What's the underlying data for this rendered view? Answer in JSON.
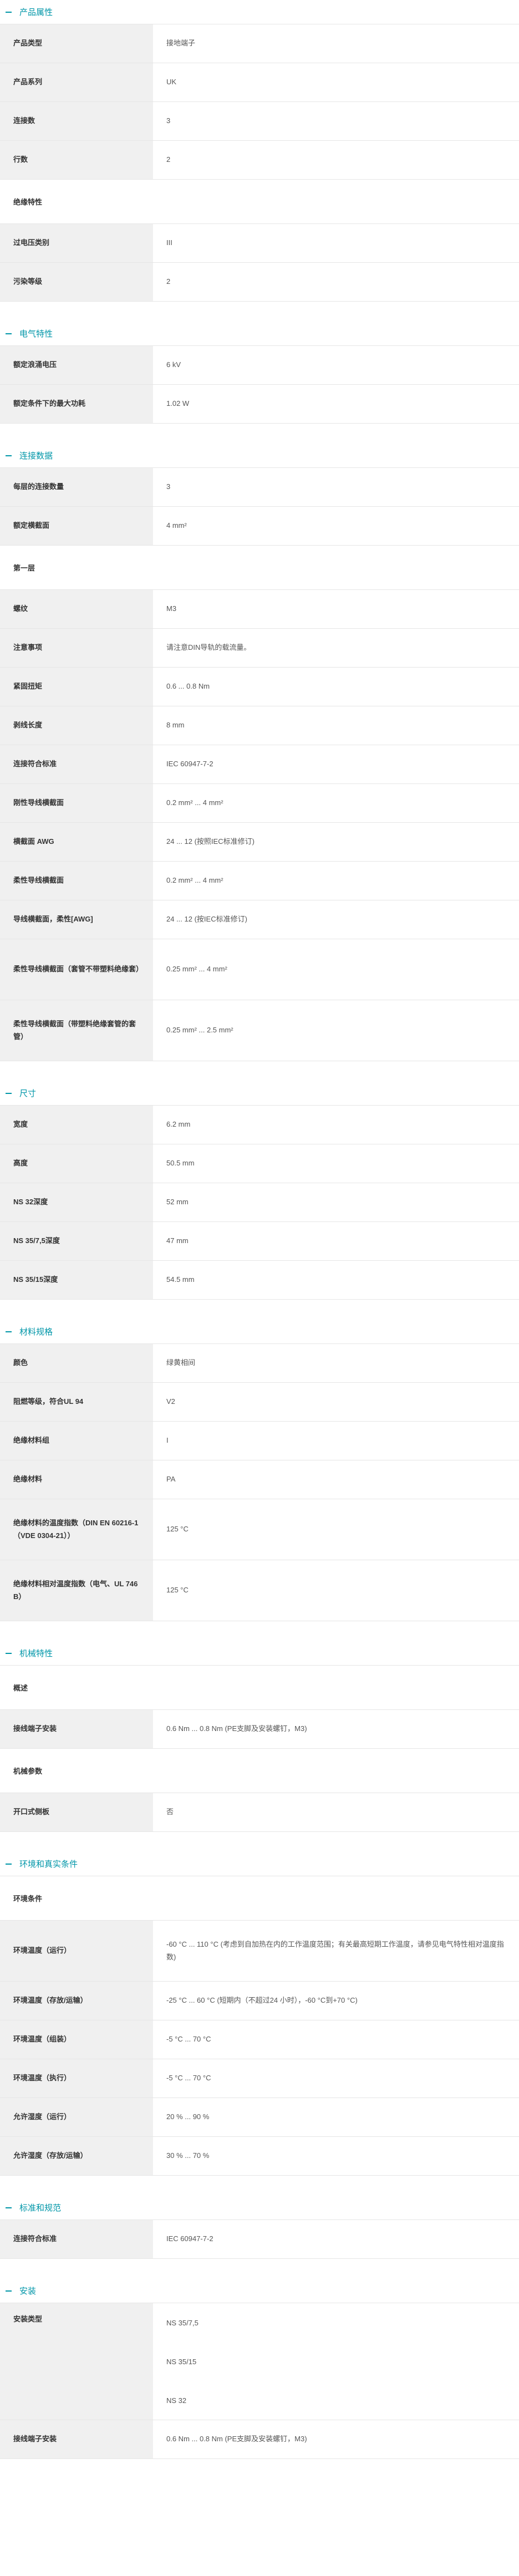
{
  "sections": {
    "product": {
      "title": "产品属性",
      "rows": [
        {
          "k": "产品类型",
          "v": "接地端子"
        },
        {
          "k": "产品系列",
          "v": "UK"
        },
        {
          "k": "连接数",
          "v": "3"
        },
        {
          "k": "行数",
          "v": "2"
        }
      ],
      "insulation_title": "绝缘特性",
      "insulation_rows": [
        {
          "k": "过电压类别",
          "v": "III"
        },
        {
          "k": "污染等级",
          "v": "2"
        }
      ]
    },
    "electrical": {
      "title": "电气特性",
      "rows": [
        {
          "k": "额定浪涌电压",
          "v": "6 kV"
        },
        {
          "k": "额定条件下的最大功耗",
          "v": "1.02 W"
        }
      ]
    },
    "connection": {
      "title": "连接数据",
      "rows": [
        {
          "k": "每层的连接数量",
          "v": "3"
        },
        {
          "k": "额定横截面",
          "v": "4 mm²"
        }
      ],
      "level_title": "第一层",
      "level_rows": [
        {
          "k": "螺纹",
          "v": "M3"
        },
        {
          "k": "注意事项",
          "v": "请注意DIN导轨的载流量。"
        },
        {
          "k": "紧固扭矩",
          "v": "0.6 ... 0.8 Nm"
        },
        {
          "k": "剥线长度",
          "v": "8 mm"
        },
        {
          "k": "连接符合标准",
          "v": "IEC 60947-7-2"
        },
        {
          "k": "刚性导线横截面",
          "v": "0.2 mm² ... 4 mm²"
        },
        {
          "k": "横截面 AWG",
          "v": "24 ... 12 (按照IEC标准修订)"
        },
        {
          "k": "柔性导线横截面",
          "v": "0.2 mm² ... 4 mm²"
        },
        {
          "k": "导线横截面，柔性[AWG]",
          "v": "24 ... 12 (按IEC标准修订)"
        },
        {
          "k": "柔性导线横截面（套管不带塑料绝缘套）",
          "v": "0.25 mm² ... 4 mm²"
        },
        {
          "k": "柔性导线横截面（带塑料绝缘套管的套管）",
          "v": "0.25 mm² ... 2.5 mm²"
        }
      ]
    },
    "dimensions": {
      "title": "尺寸",
      "rows": [
        {
          "k": "宽度",
          "v": "6.2 mm"
        },
        {
          "k": "高度",
          "v": "50.5 mm"
        },
        {
          "k": "NS 32深度",
          "v": "52 mm"
        },
        {
          "k": "NS 35/7,5深度",
          "v": "47 mm"
        },
        {
          "k": "NS 35/15深度",
          "v": "54.5 mm"
        }
      ]
    },
    "material": {
      "title": "材料规格",
      "rows": [
        {
          "k": "颜色",
          "v": "绿黄相间"
        },
        {
          "k": "阻燃等级，符合UL 94",
          "v": "V2"
        },
        {
          "k": "绝缘材料组",
          "v": "I"
        },
        {
          "k": "绝缘材料",
          "v": "PA"
        },
        {
          "k": "绝缘材料的温度指数（DIN EN 60216-1（VDE 0304-21））",
          "v": "125 °C"
        },
        {
          "k": "绝缘材料相对温度指数（电气、UL 746 B）",
          "v": "125 °C"
        }
      ]
    },
    "mechanical": {
      "title": "机械特性",
      "overview_title": "概述",
      "overview_rows": [
        {
          "k": "接线端子安装",
          "v": "0.6 Nm ... 0.8 Nm (PE支脚及安装螺钉，M3)"
        }
      ],
      "params_title": "机械参数",
      "params_rows": [
        {
          "k": "开口式侧板",
          "v": "否"
        }
      ]
    },
    "environment": {
      "title": "环境和真实条件",
      "sub_title": "环境条件",
      "rows": [
        {
          "k": "环境温度（运行）",
          "v": "-60 °C ... 110 °C (考虑到自加热在内的工作温度范围；有关最高短期工作温度，请参见电气特性相对温度指数)"
        },
        {
          "k": "环境温度（存放/运输）",
          "v": "-25 °C ... 60 °C (短期内（不超过24 小时），-60 °C到+70 °C)"
        },
        {
          "k": "环境温度（组装）",
          "v": "-5 °C ... 70 °C"
        },
        {
          "k": "环境温度（执行）",
          "v": "-5 °C ... 70 °C"
        },
        {
          "k": "允许湿度（运行）",
          "v": "20 % ... 90 %"
        },
        {
          "k": "允许湿度（存放/运输）",
          "v": "30 % ... 70 %"
        }
      ]
    },
    "standards": {
      "title": "标准和规范",
      "rows": [
        {
          "k": "连接符合标准",
          "v": "IEC 60947-7-2"
        }
      ]
    },
    "install": {
      "title": "安装",
      "mount_key": "安装类型",
      "mount_values": [
        "NS 35/7,5",
        "NS 35/15",
        "NS 32"
      ],
      "rows": [
        {
          "k": "接线端子安装",
          "v": "0.6 Nm ... 0.8 Nm (PE支脚及安装螺钉，M3)"
        }
      ]
    }
  }
}
